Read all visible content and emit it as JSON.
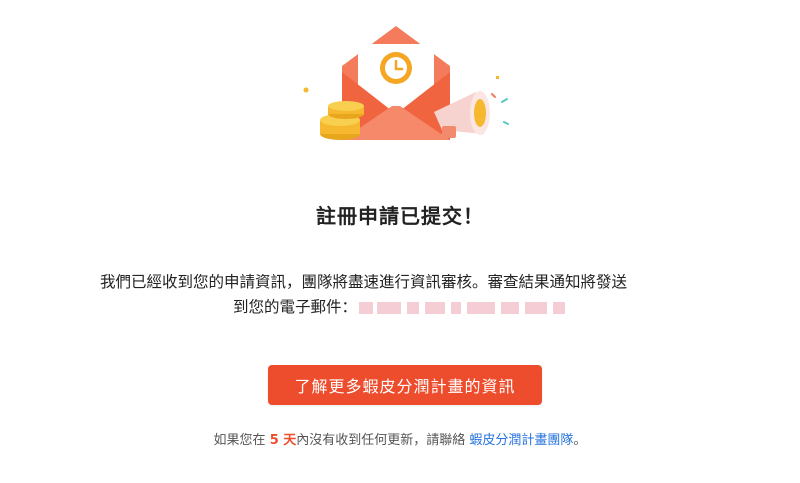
{
  "confirmation": {
    "title": "註冊申請已提交！",
    "message_line1": "我們已經收到您的申請資訊，團隊將盡速進行資訊審核。審查結果通知將發送",
    "message_line2_prefix": "到您的電子郵件："
  },
  "cta": {
    "label": "了解更多蝦皮分潤計畫的資訊"
  },
  "footnote": {
    "prefix": "如果您在 ",
    "days": "5 天",
    "middle": "內沒有收到任何更新，請聯絡 ",
    "link_text": "蝦皮分潤計畫團隊",
    "suffix": "。"
  },
  "colors": {
    "accent": "#ee4d2d",
    "link": "#2673dd"
  },
  "icons": {
    "illustration": "envelope-with-clock-coins-megaphone-illustration"
  }
}
